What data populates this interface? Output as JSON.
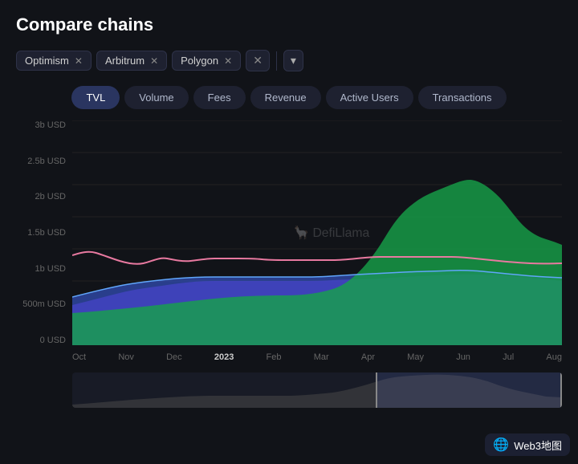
{
  "page": {
    "title": "Compare chains"
  },
  "chains": [
    {
      "label": "Optimism",
      "id": "optimism"
    },
    {
      "label": "Arbitrum",
      "id": "arbitrum"
    },
    {
      "label": "Polygon",
      "id": "polygon"
    }
  ],
  "tabs": [
    {
      "label": "TVL",
      "active": true
    },
    {
      "label": "Volume",
      "active": false
    },
    {
      "label": "Fees",
      "active": false
    },
    {
      "label": "Revenue",
      "active": false
    },
    {
      "label": "Active Users",
      "active": false
    },
    {
      "label": "Transactions",
      "active": false
    }
  ],
  "yAxis": {
    "labels": [
      "3b USD",
      "2.5b USD",
      "2b USD",
      "1.5b USD",
      "1b USD",
      "500m USD",
      "0 USD"
    ]
  },
  "xAxis": {
    "labels": [
      "Oct",
      "Nov",
      "Dec",
      "2023",
      "Feb",
      "Mar",
      "Apr",
      "May",
      "Jun",
      "Jul",
      "Aug"
    ]
  },
  "watermark": {
    "text": "DefiLlama"
  },
  "web3badge": {
    "globe": "🌐",
    "text": "Web3地图"
  },
  "colors": {
    "optimism": "#ff4f8b",
    "arbitrum": "#5b8cff",
    "polygon": "#7b3fff",
    "green": "#22c55e",
    "background": "#111318"
  }
}
